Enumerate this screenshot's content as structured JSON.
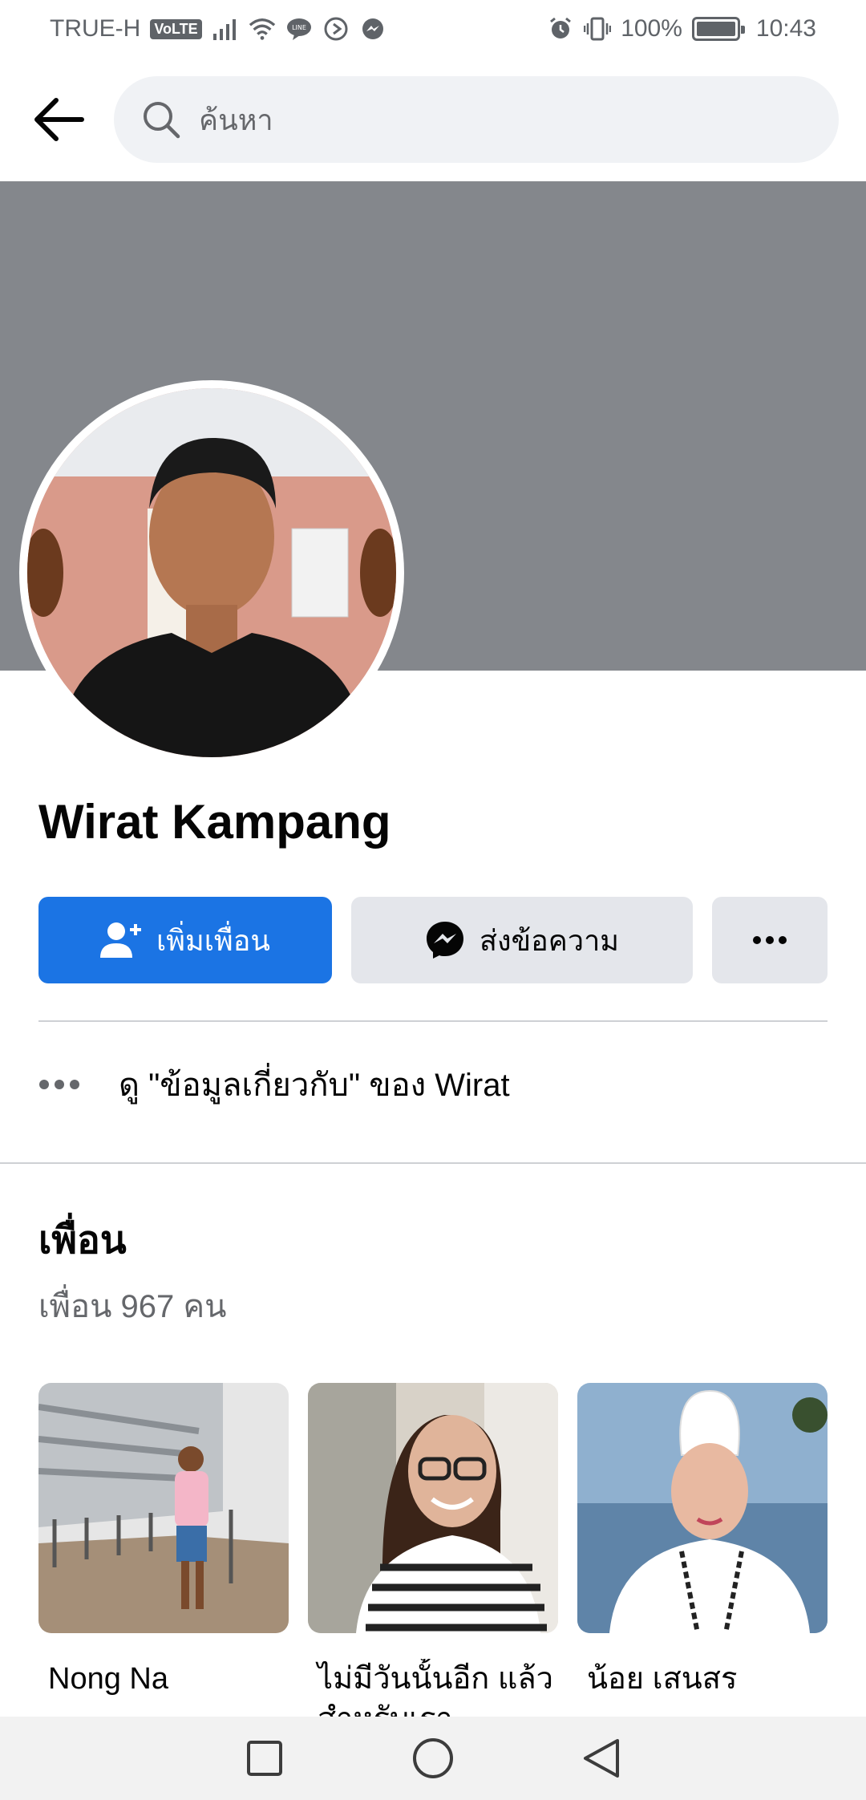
{
  "status_bar": {
    "carrier": "TRUE-H",
    "volte": "VoLTE",
    "battery": "100%",
    "time": "10:43"
  },
  "header": {
    "search_placeholder": "ค้นหา"
  },
  "profile": {
    "name": "Wirat Kampang",
    "add_friend_label": "เพิ่มเพื่อน",
    "message_label": "ส่งข้อความ",
    "about_link": "ดู \"ข้อมูลเกี่ยวกับ\" ของ Wirat"
  },
  "friends": {
    "title": "เพื่อน",
    "count_label": "เพื่อน 967 คน",
    "items": [
      {
        "name": "Nong Na"
      },
      {
        "name": "ไม่มีวันนั้นอีก แล้วสำหรับเรา"
      },
      {
        "name": "น้อย เสนสร"
      }
    ]
  },
  "colors": {
    "primary": "#1b74e4",
    "cover": "#84878c",
    "secondary_button": "#e4e6eb"
  }
}
